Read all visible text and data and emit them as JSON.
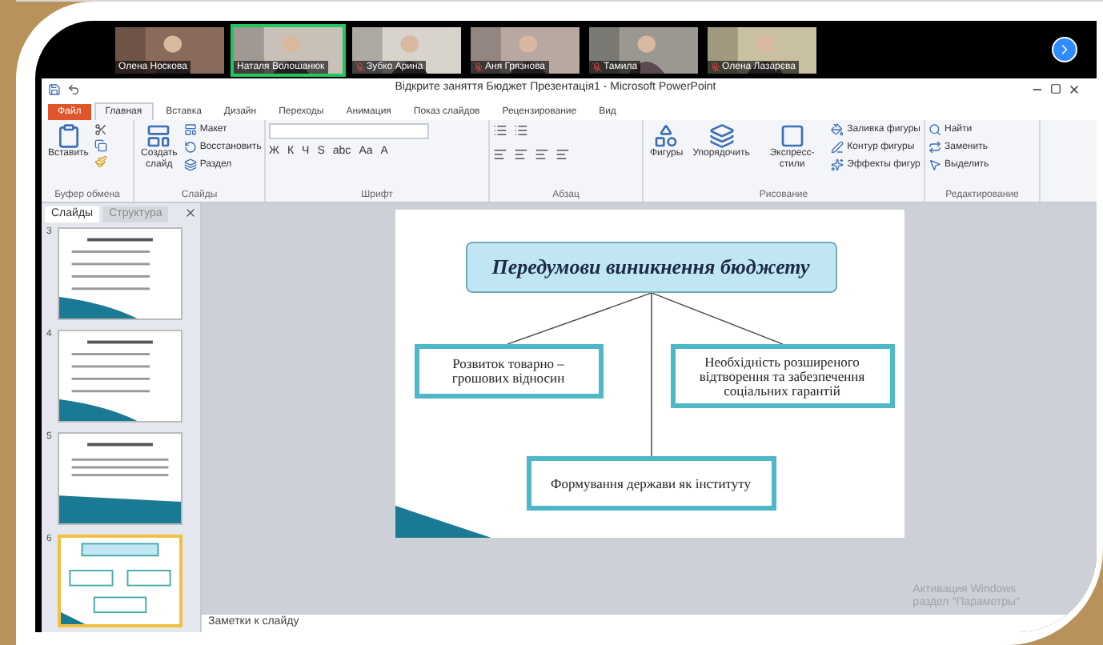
{
  "participants": [
    {
      "name": "Олена Носкова",
      "speaking": false,
      "muted": false
    },
    {
      "name": "Наталя Волошанюк",
      "speaking": true,
      "muted": false
    },
    {
      "name": "Зубко Арина",
      "speaking": false,
      "muted": true
    },
    {
      "name": "Аня Грязнова",
      "speaking": false,
      "muted": true
    },
    {
      "name": "Тамила",
      "speaking": false,
      "muted": true
    },
    {
      "name": "Олена Лазарєва",
      "speaking": false,
      "muted": true
    }
  ],
  "window": {
    "title": "Відкрите заняття Бюджет Презентація1  -  Microsoft PowerPoint"
  },
  "tabs": [
    {
      "label": "Файл",
      "selected": false,
      "kind": "file"
    },
    {
      "label": "Главная",
      "selected": true,
      "kind": "tab"
    },
    {
      "label": "Вставка",
      "selected": false,
      "kind": "tab"
    },
    {
      "label": "Дизайн",
      "selected": false,
      "kind": "tab"
    },
    {
      "label": "Переходы",
      "selected": false,
      "kind": "tab"
    },
    {
      "label": "Анимация",
      "selected": false,
      "kind": "tab"
    },
    {
      "label": "Показ слайдов",
      "selected": false,
      "kind": "tab"
    },
    {
      "label": "Рецензирование",
      "selected": false,
      "kind": "tab"
    },
    {
      "label": "Вид",
      "selected": false,
      "kind": "tab"
    }
  ],
  "ribbon": {
    "clipboard": {
      "label": "Буфер обмена",
      "paste": "Вставить"
    },
    "slides": {
      "label": "Слайды",
      "new_slide": "Создать слайд",
      "layout": "Макет",
      "reset": "Восстановить",
      "section": "Раздел"
    },
    "font": {
      "label": "Шрифт",
      "buttons": [
        "Ж",
        "К",
        "Ч",
        "S",
        "abc",
        "Aa",
        "A"
      ]
    },
    "paragraph": {
      "label": "Абзац"
    },
    "drawing": {
      "label": "Рисование",
      "shapes": "Фигуры",
      "arrange": "Упорядочить",
      "styles": "Экспресс-стили",
      "fill": "Заливка фигуры",
      "outline": "Контур фигуры",
      "effects": "Эффекты фигур"
    },
    "editing": {
      "label": "Редактирование",
      "find": "Найти",
      "replace": "Заменить",
      "select": "Выделить"
    }
  },
  "side_panel": {
    "tabs": [
      {
        "label": "Слайды",
        "selected": true
      },
      {
        "label": "Структура",
        "selected": false
      }
    ],
    "slides": [
      {
        "number": "3",
        "selected": false,
        "kind": "list"
      },
      {
        "number": "4",
        "selected": false,
        "kind": "list"
      },
      {
        "number": "5",
        "selected": false,
        "kind": "text"
      },
      {
        "number": "6",
        "selected": true,
        "kind": "diagram"
      }
    ]
  },
  "slide": {
    "title": "Передумови виникнення бюджету",
    "boxes": [
      "Розвиток товарно – грошових відносин",
      "Необхідність розширеного відтворення та забезпечення соціальних гарантій",
      "Формування держави як інституту"
    ]
  },
  "notes_placeholder": "Заметки к слайду",
  "activation": [
    "Активация Windows",
    "раздел \"Параметры\""
  ]
}
